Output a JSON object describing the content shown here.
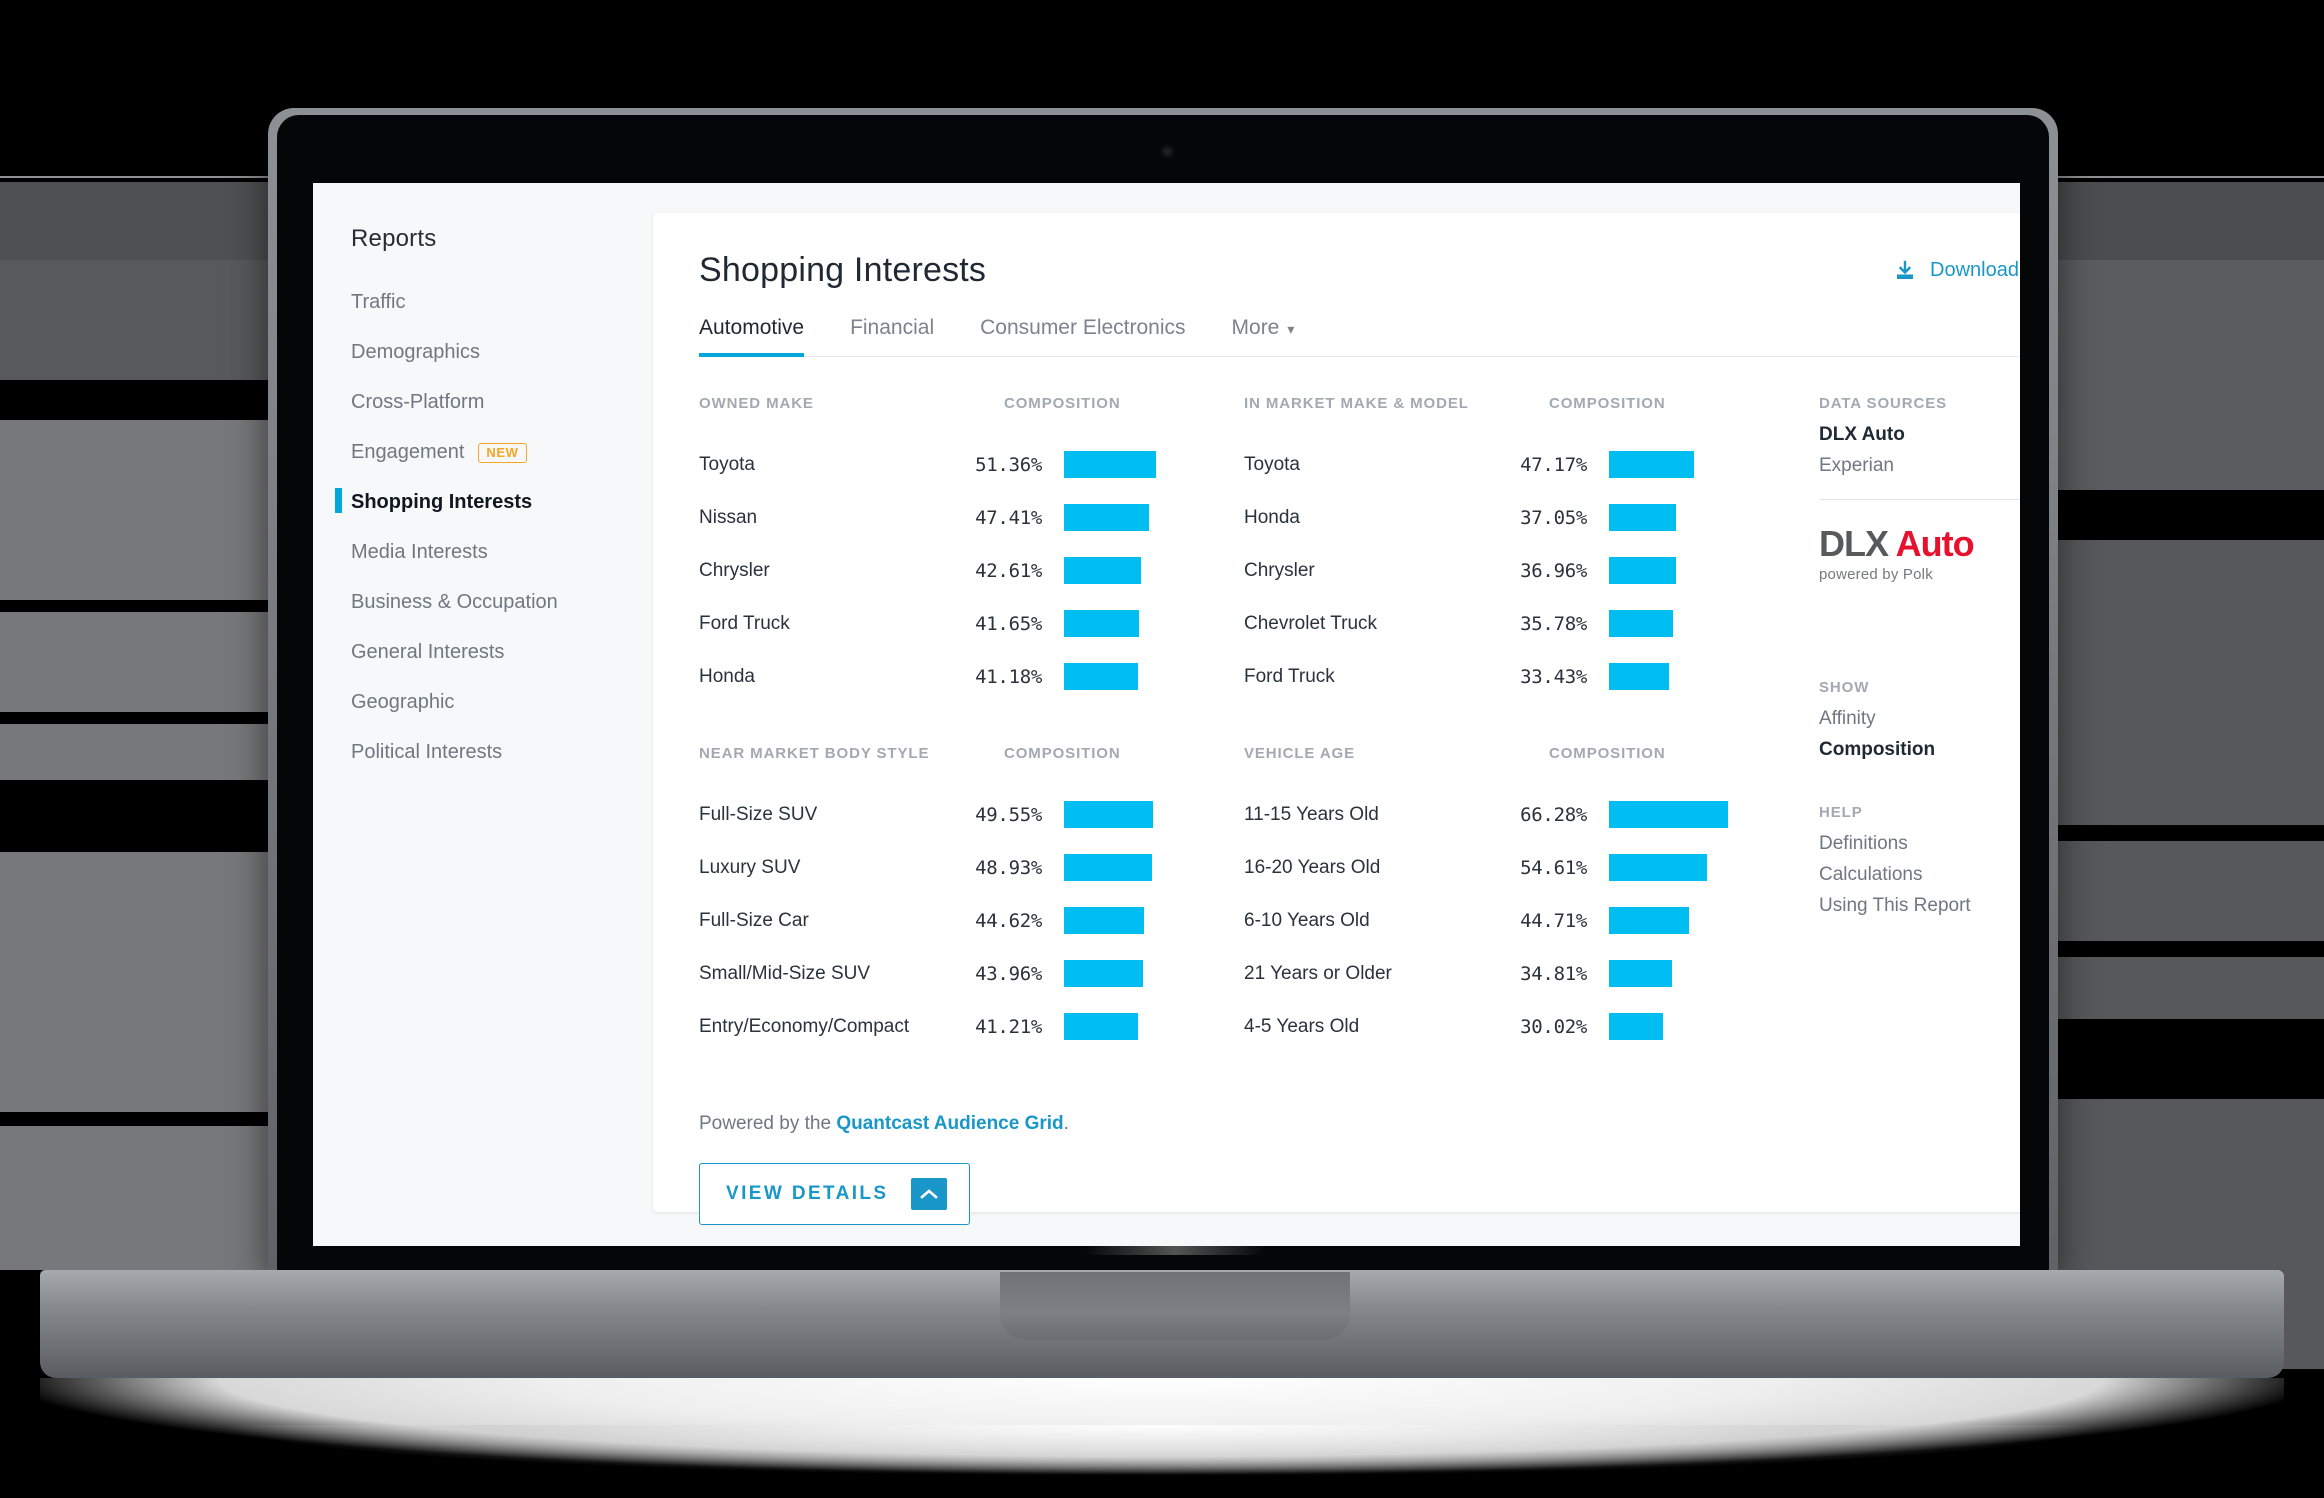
{
  "sidebar": {
    "title": "Reports",
    "items": [
      {
        "label": "Traffic",
        "active": false
      },
      {
        "label": "Demographics",
        "active": false
      },
      {
        "label": "Cross-Platform",
        "active": false
      },
      {
        "label": "Engagement",
        "active": false,
        "badge": "NEW"
      },
      {
        "label": "Shopping Interests",
        "active": true
      },
      {
        "label": "Media Interests",
        "active": false
      },
      {
        "label": "Business & Occupation",
        "active": false
      },
      {
        "label": "General Interests",
        "active": false
      },
      {
        "label": "Geographic",
        "active": false
      },
      {
        "label": "Political Interests",
        "active": false
      }
    ]
  },
  "header": {
    "title": "Shopping Interests",
    "download_label": "Download",
    "download_icon": "download-icon"
  },
  "tabs": [
    {
      "label": "Automotive",
      "active": true
    },
    {
      "label": "Financial",
      "active": false
    },
    {
      "label": "Consumer Electronics",
      "active": false
    },
    {
      "label": "More",
      "active": false,
      "caret": "▾"
    }
  ],
  "tables": [
    {
      "header": "OWNED MAKE",
      "comp_header": "COMPOSITION",
      "rows": [
        {
          "label": "Toyota",
          "value": "51.36%"
        },
        {
          "label": "Nissan",
          "value": "47.41%"
        },
        {
          "label": "Chrysler",
          "value": "42.61%"
        },
        {
          "label": "Ford Truck",
          "value": "41.65%"
        },
        {
          "label": "Honda",
          "value": "41.18%"
        }
      ]
    },
    {
      "header": "IN MARKET MAKE & MODEL",
      "comp_header": "COMPOSITION",
      "rows": [
        {
          "label": "Toyota",
          "value": "47.17%"
        },
        {
          "label": "Honda",
          "value": "37.05%"
        },
        {
          "label": "Chrysler",
          "value": "36.96%"
        },
        {
          "label": "Chevrolet Truck",
          "value": "35.78%"
        },
        {
          "label": "Ford Truck",
          "value": "33.43%"
        }
      ]
    },
    {
      "header": "NEAR MARKET BODY STYLE",
      "comp_header": "COMPOSITION",
      "rows": [
        {
          "label": "Full-Size SUV",
          "value": "49.55%"
        },
        {
          "label": "Luxury SUV",
          "value": "48.93%"
        },
        {
          "label": "Full-Size Car",
          "value": "44.62%"
        },
        {
          "label": "Small/Mid-Size SUV",
          "value": "43.96%"
        },
        {
          "label": "Entry/Economy/Compact",
          "value": "41.21%"
        }
      ]
    },
    {
      "header": "VEHICLE AGE",
      "comp_header": "COMPOSITION",
      "rows": [
        {
          "label": "11-15 Years Old",
          "value": "66.28%"
        },
        {
          "label": "16-20 Years Old",
          "value": "54.61%"
        },
        {
          "label": "6-10 Years Old",
          "value": "44.71%"
        },
        {
          "label": "21 Years or Older",
          "value": "34.81%"
        },
        {
          "label": "4-5 Years Old",
          "value": "30.02%"
        }
      ]
    }
  ],
  "rail": {
    "data_sources_header": "DATA SOURCES",
    "data_sources": [
      {
        "label": "DLX Auto",
        "strong": true
      },
      {
        "label": "Experian",
        "strong": false
      }
    ],
    "logo": {
      "part1": "DLX",
      "part2": "Auto",
      "sub": "powered by Polk"
    },
    "show_header": "SHOW",
    "show_options": [
      {
        "label": "Affinity",
        "selected": false
      },
      {
        "label": "Composition",
        "selected": true
      }
    ],
    "help_header": "HELP",
    "help_links": [
      {
        "label": "Definitions"
      },
      {
        "label": "Calculations"
      },
      {
        "label": "Using This Report"
      }
    ]
  },
  "footer": {
    "powered_prefix": "Powered by the ",
    "powered_link": "Quantcast Audience Grid",
    "powered_suffix": ".",
    "view_details_label": "VIEW DETAILS",
    "view_details_icon": "chevron-up-icon"
  },
  "chart_data": {
    "type": "bar",
    "title": "Shopping Interests — Automotive",
    "metric": "Composition",
    "unit": "%",
    "xlim": [
      0,
      100
    ],
    "charts": [
      {
        "name": "Owned Make",
        "categories": [
          "Toyota",
          "Nissan",
          "Chrysler",
          "Ford Truck",
          "Honda"
        ],
        "values": [
          51.36,
          47.41,
          42.61,
          41.65,
          41.18
        ]
      },
      {
        "name": "In Market Make & Model",
        "categories": [
          "Toyota",
          "Honda",
          "Chrysler",
          "Chevrolet Truck",
          "Ford Truck"
        ],
        "values": [
          47.17,
          37.05,
          36.96,
          35.78,
          33.43
        ]
      },
      {
        "name": "Near Market Body Style",
        "categories": [
          "Full-Size SUV",
          "Luxury SUV",
          "Full-Size Car",
          "Small/Mid-Size SUV",
          "Entry/Economy/Compact"
        ],
        "values": [
          49.55,
          48.93,
          44.62,
          43.96,
          41.21
        ]
      },
      {
        "name": "Vehicle Age",
        "categories": [
          "11-15 Years Old",
          "16-20 Years Old",
          "6-10 Years Old",
          "21 Years or Older",
          "4-5 Years Old"
        ],
        "values": [
          66.28,
          54.61,
          44.71,
          34.81,
          30.02
        ]
      }
    ],
    "bar_color": "#00BDF2",
    "grid": false,
    "legend": "none"
  },
  "colors": {
    "accent": "#00A9D9",
    "bar": "#00BDF2",
    "link": "#1A97C9",
    "badge": "#F5A623",
    "logo_red": "#E8112D"
  }
}
